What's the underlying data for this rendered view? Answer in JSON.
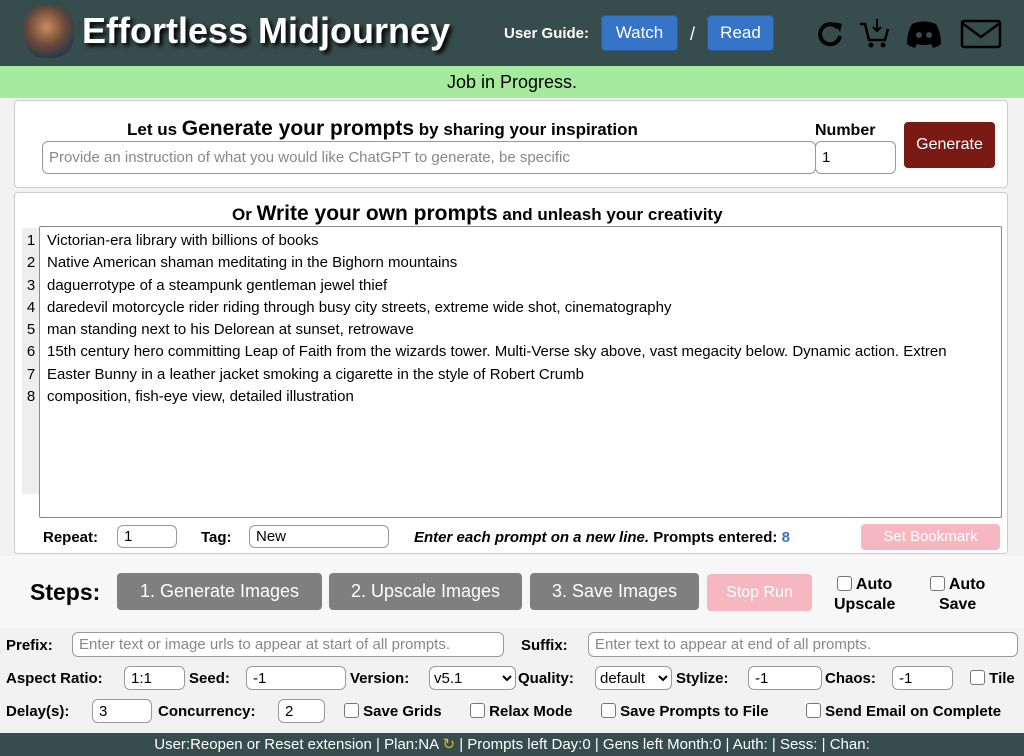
{
  "header": {
    "title": "Effortless Midjourney",
    "guide_label": "User Guide:",
    "watch": "Watch",
    "separator": "/",
    "read": "Read"
  },
  "status": "Job in Progress.",
  "generate": {
    "heading_pre": "Let us ",
    "heading_big": "Generate your prompts",
    "heading_post": " by sharing your inspiration",
    "placeholder": "Provide an instruction of what you would like ChatGPT to generate, be specific",
    "number_label": "Number",
    "number_value": "1",
    "button": "Generate"
  },
  "own": {
    "heading_pre": "Or ",
    "heading_big": "Write your own prompts",
    "heading_post": " and unleash your creativity",
    "lines": [
      "Victorian-era library with billions of books",
      "Native American shaman meditating in the Bighorn mountains",
      "daguerrotype of a steampunk gentleman jewel thief",
      "daredevil motorcycle rider riding through busy city streets, extreme wide shot, cinematography",
      "man standing next to his Delorean at sunset, retrowave",
      "15th century hero committing Leap of Faith from the wizards tower. Multi-Verse sky above, vast megacity below. Dynamic action. Extren",
      "Easter Bunny in a leather jacket smoking a cigarette in the style of Robert Crumb",
      "composition, fish-eye view, detailed illustration"
    ],
    "line_numbers": [
      "1",
      "2",
      "3",
      "4",
      "5",
      "6",
      "7",
      "8"
    ],
    "repeat_label": "Repeat:",
    "repeat_value": "1",
    "tag_label": "Tag:",
    "tag_value": "New",
    "hint": "Enter each prompt on a new line.",
    "count_label": "Prompts entered:",
    "count": "8",
    "bookmark": "Set Bookmark"
  },
  "steps": {
    "label": "Steps:",
    "b1": "1. Generate Images",
    "b2": "2. Upscale Images",
    "b3": "3. Save Images",
    "stop": "Stop Run",
    "auto_upscale": [
      "Auto",
      "Upscale"
    ],
    "auto_save": [
      "Auto",
      "Save"
    ]
  },
  "settings": {
    "prefix_label": "Prefix:",
    "prefix_placeholder": "Enter text or image urls to appear at start of all prompts.",
    "suffix_label": "Suffix:",
    "suffix_placeholder": "Enter text to appear at end of all prompts.",
    "ar_label": "Aspect Ratio:",
    "ar": "1:1",
    "seed_label": "Seed:",
    "seed": "-1",
    "version_label": "Version:",
    "version": "v5.1",
    "quality_label": "Quality:",
    "quality": "default",
    "stylize_label": "Stylize:",
    "stylize": "-1",
    "chaos_label": "Chaos:",
    "chaos": "-1",
    "tile": "Tile",
    "delay_label": "Delay(s):",
    "delay": "3",
    "concurrency_label": "Concurrency:",
    "concurrency": "2",
    "save_grids": "Save Grids",
    "relax": "Relax Mode",
    "save_prompts": "Save Prompts to File",
    "send_email": "Send Email on Complete"
  },
  "footer": {
    "user": "User:Reopen or Reset extension",
    "plan": " | Plan:NA ",
    "refresh": "↻",
    "rest": " | Prompts left Day:0  | Gens left Month:0  | Auth:  | Sess:  | Chan:"
  },
  "colors": {
    "header": "#374d4d",
    "status": "#a6eb9d",
    "blue": "#3574c6",
    "generate": "#7a1a14",
    "step": "#7f7f7f",
    "disabled": "#f6b8c0",
    "count": "#3574c6"
  }
}
